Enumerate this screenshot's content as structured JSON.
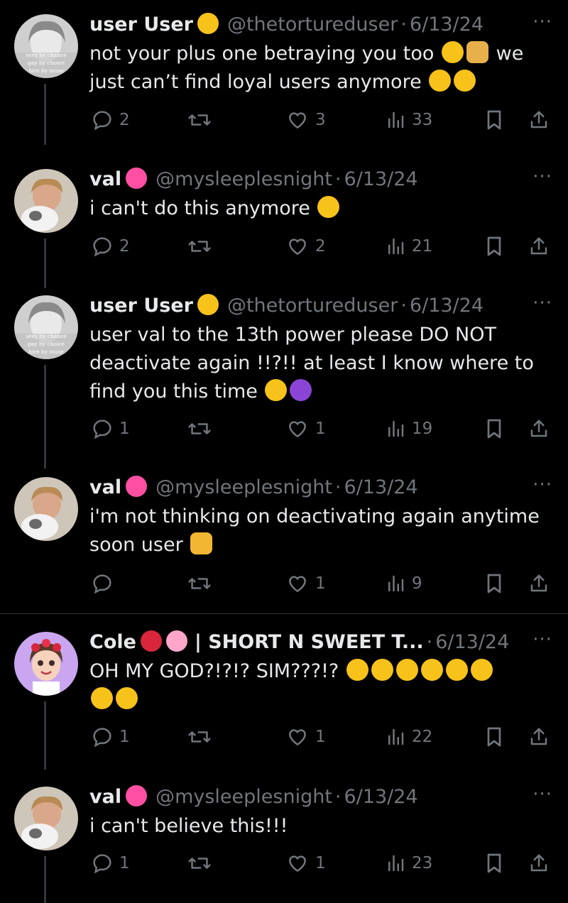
{
  "tweets": [
    {
      "name": "user User",
      "handle": "@thetortureduser",
      "date": "6/13/24",
      "lines": [
        "not your plus one betraying you too",
        "we",
        "just can’t find loyal users anymore"
      ],
      "replies": "2",
      "retweets": "",
      "likes": "3",
      "views": "33",
      "avatar_text": [
        "sexy by chance",
        "gay by choice",
        "hire by muse"
      ]
    },
    {
      "name": "val",
      "handle": "@mysleeplesnight",
      "date": "6/13/24",
      "lines": [
        "i can't do this anymore"
      ],
      "replies": "2",
      "retweets": "",
      "likes": "2",
      "views": "21"
    },
    {
      "name": "user User",
      "handle": "@thetortureduser",
      "date": "6/13/24",
      "lines": [
        "user val to the 13th power please DO NOT",
        "deactivate again !!?!! at least I know where to",
        "find you this time"
      ],
      "replies": "1",
      "retweets": "",
      "likes": "1",
      "views": "19",
      "avatar_text": [
        "sexy by chance",
        "gay by choice",
        "hire by muse"
      ]
    },
    {
      "name": "val",
      "handle": "@mysleeplesnight",
      "date": "6/13/24",
      "lines": [
        "i'm not thinking on deactivating again anytime",
        "soon user"
      ],
      "replies": "",
      "retweets": "",
      "likes": "1",
      "views": "9"
    },
    {
      "name": "Cole",
      "handle": "| SHORT N SWEET T...",
      "date": "6/13/24",
      "lines": [
        "OH MY GOD?!?!? SIM???!?"
      ],
      "replies": "1",
      "retweets": "",
      "likes": "1",
      "views": "22"
    },
    {
      "name": "val",
      "handle": "@mysleeplesnight",
      "date": "6/13/24",
      "lines": [
        "i can't believe this!!!"
      ],
      "replies": "1",
      "retweets": "",
      "likes": "1",
      "views": "23"
    }
  ],
  "ui": {
    "dot": "·",
    "more": "···"
  },
  "colors": {
    "background": "#000000",
    "text": "#e7e9ea",
    "muted": "#71767b",
    "divider": "#2f3336",
    "heart_emoji": "#ff4fa3"
  },
  "icons": [
    "reply-icon",
    "retweet-icon",
    "like-icon",
    "views-icon",
    "bookmark-icon",
    "share-icon",
    "more-icon"
  ]
}
